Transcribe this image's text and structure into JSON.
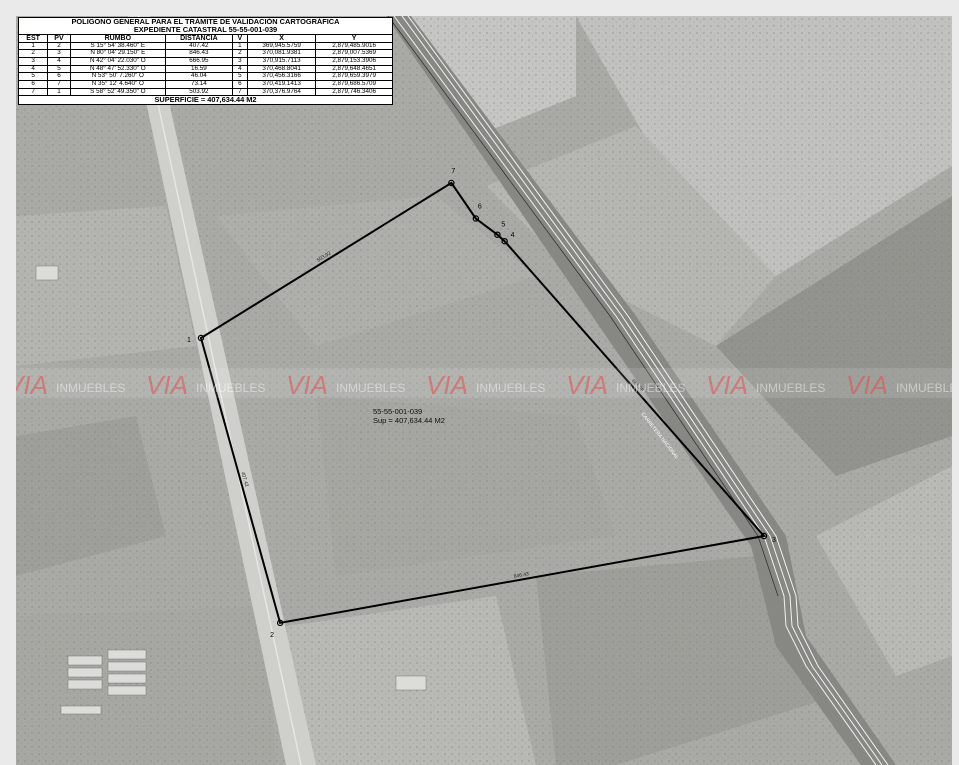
{
  "table": {
    "title": "POLIGONO GENERAL PARA EL TRÁMITE DE VALIDACIÓN CARTOGRÁFICA",
    "subtitle": "EXPEDIENTE CATASTRAL 55-55-001-039",
    "headers": [
      "EST",
      "PV",
      "RUMBO",
      "DISTANCIA",
      "V",
      "X",
      "Y"
    ],
    "rows": [
      [
        "1",
        "2",
        "S 15° 54' 38.460\" E",
        "407.42",
        "1",
        "369,945.5759",
        "2,879,485.9016"
      ],
      [
        "2",
        "3",
        "N 80° 04' 29.150\" E",
        "846.43",
        "2",
        "370,081.9381",
        "2,879,007.5369"
      ],
      [
        "3",
        "4",
        "N 42° 04' 22.030\" O",
        "666.95",
        "3",
        "370,915.7113",
        "2,879,153.3906"
      ],
      [
        "4",
        "5",
        "N 48° 47' 52.330\" O",
        "16.59",
        "4",
        "370,468.8041",
        "2,879,648.4651"
      ],
      [
        "5",
        "6",
        "N 53° 50' 7.260\" O",
        "46.04",
        "5",
        "370,456.3166",
        "2,879,659.3979"
      ],
      [
        "6",
        "7",
        "N 35° 12' 4.640\" O",
        "73.14",
        "6",
        "370,419.1413",
        "2,879,686.5709"
      ],
      [
        "7",
        "1",
        "S 58° 52' 49.350\" O",
        "503.92",
        "7",
        "370,376.9764",
        "2,879,746.3406"
      ]
    ],
    "superficie": "SUPERFICIE = 407,634.44 M2"
  },
  "map": {
    "parcel_id": "55-55-001-039",
    "parcel_area": "Sup = 407,634.44 M2",
    "vertices": [
      {
        "label": "1",
        "x": 369945.5759,
        "y": 2879485.9016
      },
      {
        "label": "2",
        "x": 370081.9381,
        "y": 2879007.5369
      },
      {
        "label": "3",
        "x": 370915.7113,
        "y": 2879153.3906
      },
      {
        "label": "4",
        "x": 370468.8041,
        "y": 2879648.4651
      },
      {
        "label": "5",
        "x": 370456.3166,
        "y": 2879659.3979
      },
      {
        "label": "6",
        "x": 370419.1413,
        "y": 2879686.5709
      },
      {
        "label": "7",
        "x": 370376.9764,
        "y": 2879746.3406
      }
    ],
    "edge_labels": [
      "407.42",
      "846.43",
      "666.95",
      "503.92"
    ],
    "road_label": "CARRETERA NACIONAL",
    "watermark": "VIA INMUEBLES",
    "colors": {
      "boundary": "#000000",
      "watermark": "#e05050",
      "imagery": "#a9a9a5"
    }
  }
}
